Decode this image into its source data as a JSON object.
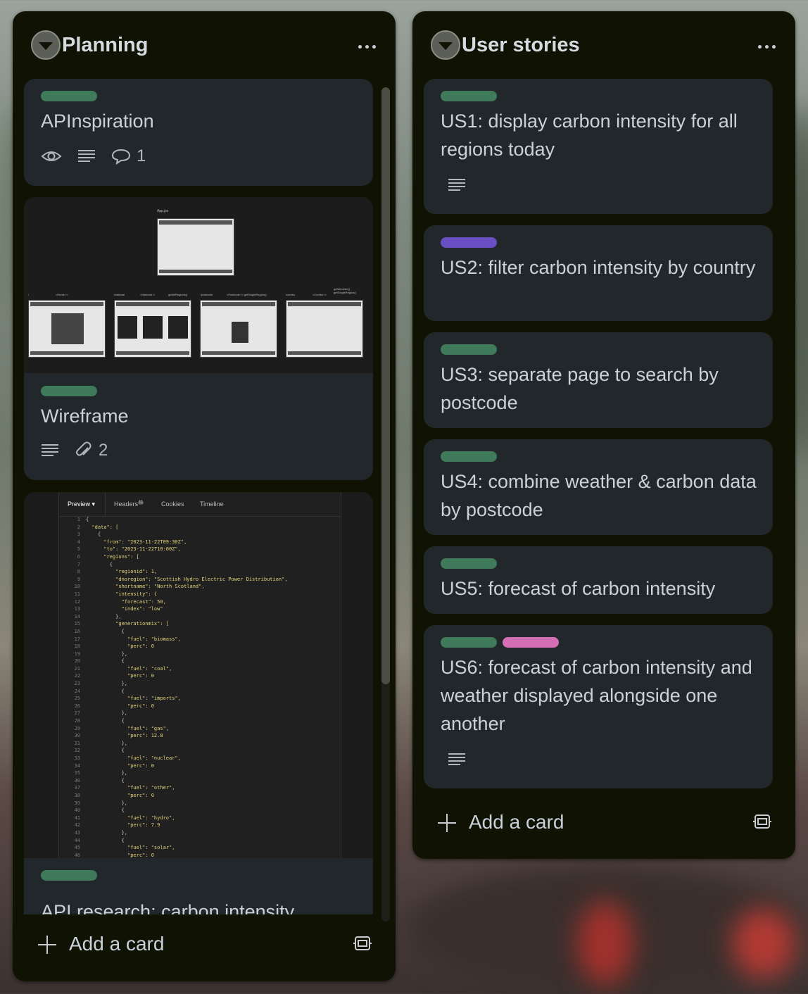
{
  "lists": [
    {
      "title": "Planning",
      "cards": [
        {
          "title": "APInspiration",
          "labels": [
            "#3f7a5b"
          ],
          "comment_count": "1"
        },
        {
          "title": "Wireframe",
          "labels": [
            "#3f7a5b"
          ],
          "attachment_count": "2",
          "cover": {
            "main_label": "App.jsx",
            "captions": [
              "/",
              "<Home />",
              "/national",
              "<National />",
              "getAllRegions()",
              "/postcode",
              "<Postcode /> getSingleRegion()",
              "/combo",
              "<Combo />",
              "getWeather() getSingleRegion()"
            ]
          }
        },
        {
          "title": "API research: carbon intensity",
          "labels": [
            "#3f7a5b"
          ],
          "cover": {
            "tabs": [
              "Preview ▾",
              "Headers",
              "Cookies",
              "Timeline"
            ],
            "headers_count": "11",
            "lines": [
              "{",
              "  \"data\": [",
              "    {",
              "      \"from\": \"2023-11-22T09:30Z\",",
              "      \"to\": \"2023-11-22T10:00Z\",",
              "      \"regions\": [",
              "        {",
              "          \"regionid\": 1,",
              "          \"dnoregion\": \"Scottish Hydro Electric Power Distribution\",",
              "          \"shortname\": \"North Scotland\",",
              "          \"intensity\": {",
              "            \"forecast\": 50,",
              "            \"index\": \"low\"",
              "          },",
              "          \"generationmix\": [",
              "            {",
              "              \"fuel\": \"biomass\",",
              "              \"perc\": 0",
              "            },",
              "            {",
              "              \"fuel\": \"coal\",",
              "              \"perc\": 0",
              "            },",
              "            {",
              "              \"fuel\": \"imports\",",
              "              \"perc\": 0",
              "            },",
              "            {",
              "              \"fuel\": \"gas\",",
              "              \"perc\": 12.8",
              "            },",
              "            {",
              "              \"fuel\": \"nuclear\",",
              "              \"perc\": 0",
              "            },",
              "            {",
              "              \"fuel\": \"other\",",
              "              \"perc\": 0",
              "            },",
              "            {",
              "              \"fuel\": \"hydro\",",
              "              \"perc\": 7.9",
              "            },",
              "            {",
              "              \"fuel\": \"solar\",",
              "              \"perc\": 0"
            ]
          }
        }
      ],
      "add_label": "Add a card"
    },
    {
      "title": "User stories",
      "cards": [
        {
          "title": "US1: display carbon intensity for all regions today",
          "labels": [
            "#3f7a5b"
          ],
          "has_description": true
        },
        {
          "title": "US2: filter carbon intensity by country",
          "labels": [
            "#6a4fc4"
          ]
        },
        {
          "title": "US3: separate page to search by postcode",
          "labels": [
            "#3f7a5b"
          ]
        },
        {
          "title": "US4: combine weather & carbon data by postcode",
          "labels": [
            "#3f7a5b"
          ]
        },
        {
          "title": "US5: forecast of carbon intensity",
          "labels": [
            "#3f7a5b"
          ]
        },
        {
          "title": "US6: forecast of carbon intensity and weather displayed alongside one another",
          "labels": [
            "#3f7a5b",
            "#d56fb5"
          ],
          "has_description": true
        }
      ],
      "add_label": "Add a card"
    }
  ]
}
